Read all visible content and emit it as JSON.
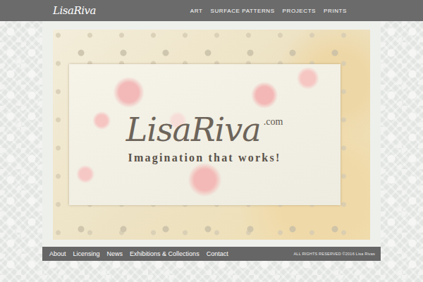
{
  "header": {
    "logo": "LisaRiva",
    "nav": [
      {
        "label": "ART"
      },
      {
        "label": "SURFACE PATTERNS"
      },
      {
        "label": "PROJECTS"
      },
      {
        "label": "PRINTS"
      }
    ]
  },
  "hero": {
    "title": "LisaRiva",
    "suffix": ".com",
    "tagline": "Imagination that works!"
  },
  "footer": {
    "links": [
      {
        "label": "About"
      },
      {
        "label": "Licensing"
      },
      {
        "label": "News"
      },
      {
        "label": "Exhibitions & Collections"
      },
      {
        "label": "Contact"
      }
    ],
    "copyright": "ALL RIGHTS RESERVED ©2016 Lisa Rivas"
  }
}
